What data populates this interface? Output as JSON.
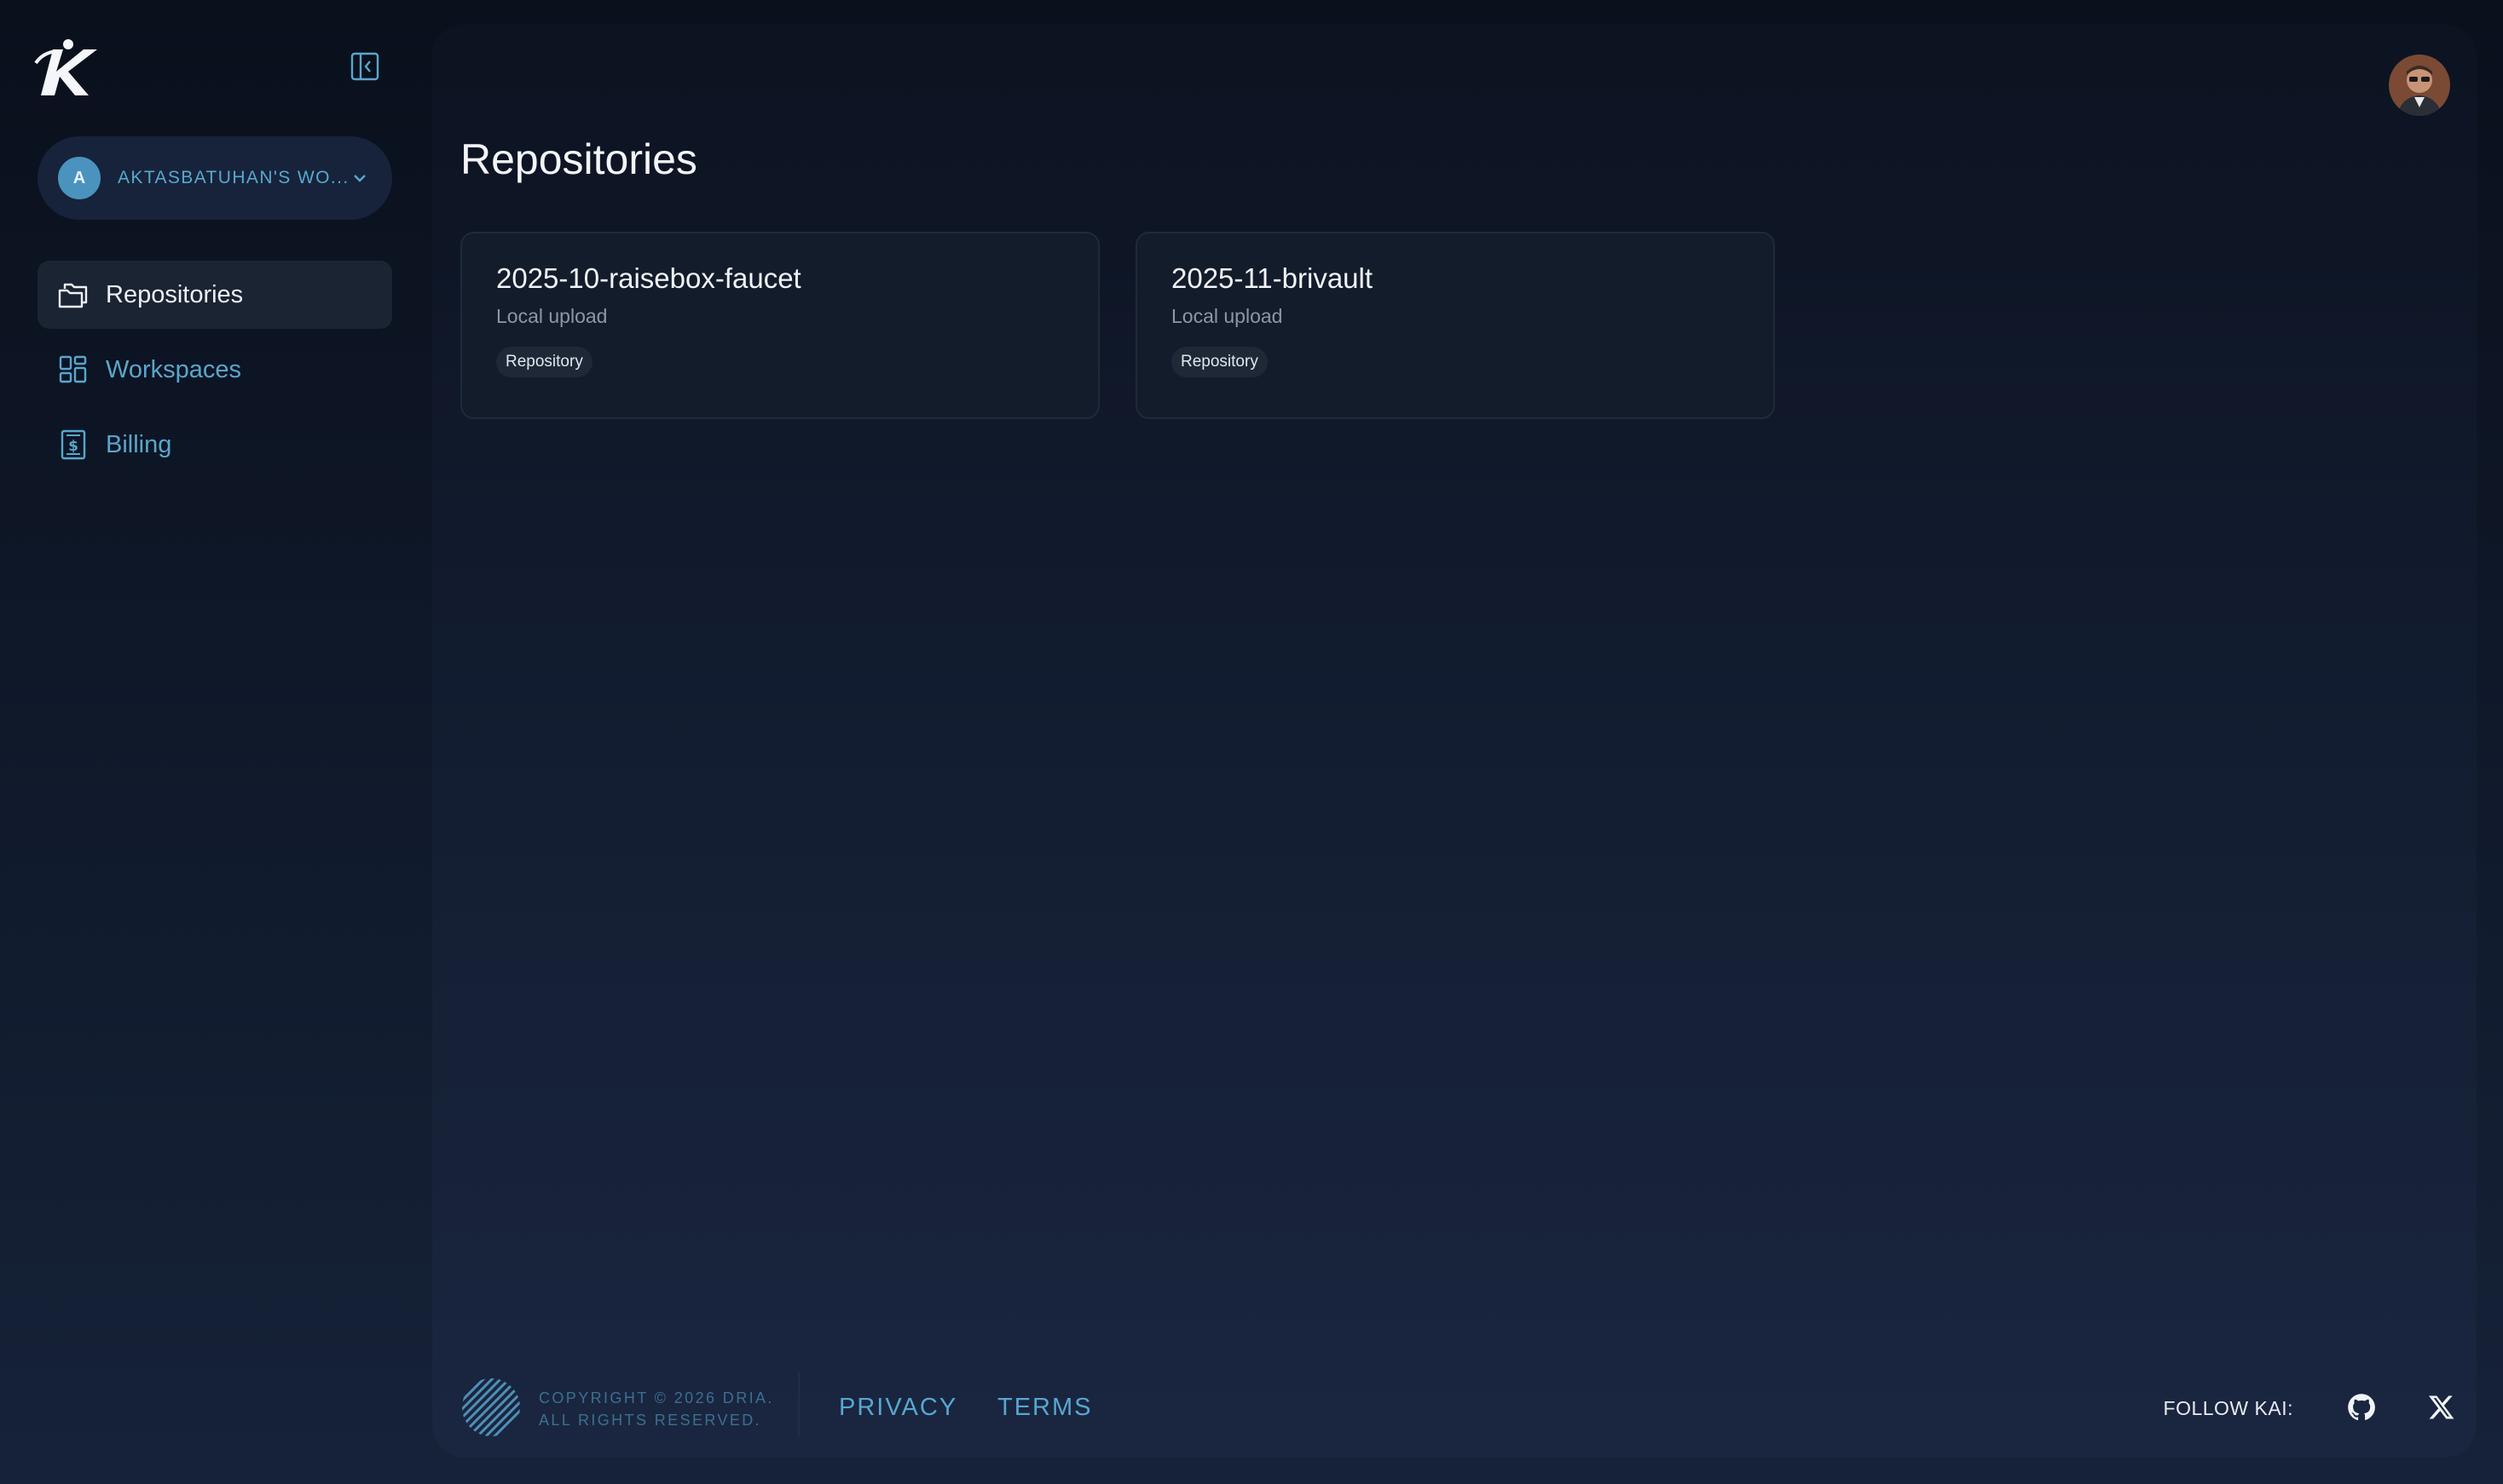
{
  "sidebar": {
    "logo_icon": "kai-logo-icon",
    "collapse_icon": "sidebar-collapse-icon",
    "workspace": {
      "initial": "A",
      "name": "AKTASBATUHAN'S WO...",
      "chevron_icon": "chevron-down-icon"
    },
    "items": [
      {
        "label": "Repositories",
        "icon": "folders-icon",
        "active": true
      },
      {
        "label": "Workspaces",
        "icon": "grid-icon",
        "active": false
      },
      {
        "label": "Billing",
        "icon": "dollar-receipt-icon",
        "active": false
      }
    ]
  },
  "main": {
    "title": "Repositories",
    "user_avatar_icon": "user-avatar",
    "cards": [
      {
        "title": "2025-10-raisebox-faucet",
        "subtitle": "Local upload",
        "tag": "Repository"
      },
      {
        "title": "2025-11-brivault",
        "subtitle": "Local upload",
        "tag": "Repository"
      }
    ]
  },
  "footer": {
    "copyright_line1": "COPYRIGHT © 2026 DRIA.",
    "copyright_line2": "ALL RIGHTS RESERVED.",
    "privacy": "PRIVACY",
    "terms": "TERMS",
    "follow": "FOLLOW KAI:",
    "social_icons": [
      "github-icon",
      "x-icon"
    ]
  },
  "colors": {
    "background": "#0b1220",
    "accent": "#57a7d2",
    "card": "#131c2b",
    "text": "#f1f4f8"
  }
}
